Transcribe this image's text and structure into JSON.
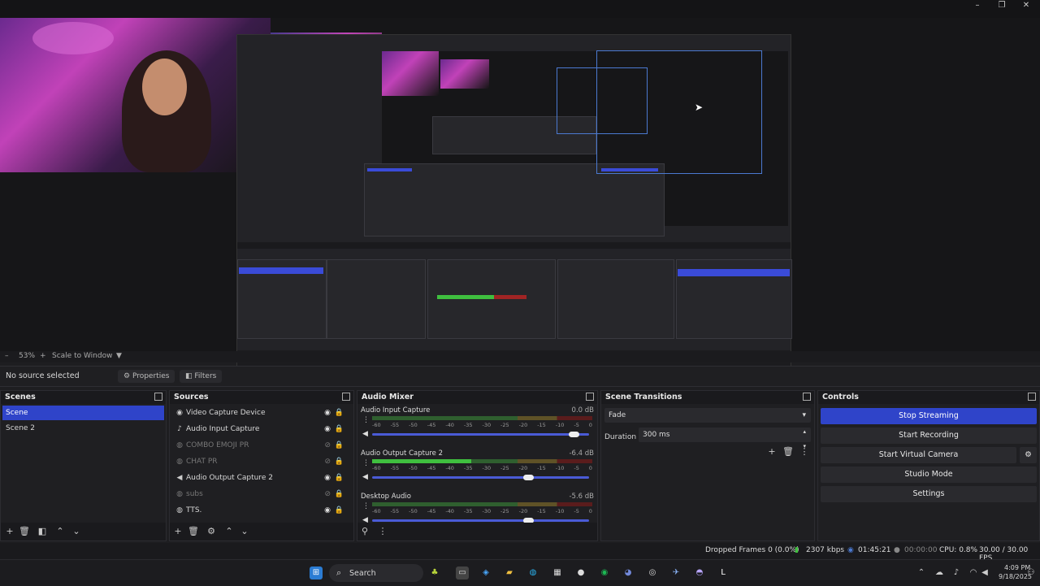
{
  "preview_toolbar": {
    "minus": "–",
    "zoom": "53%",
    "plus": "+",
    "scale_mode": "Scale to Window"
  },
  "props_bar": {
    "no_source": "No source selected",
    "properties": "Properties",
    "filters": "Filters"
  },
  "scenes": {
    "title": "Scenes",
    "items": [
      "Scene",
      "Scene 2"
    ]
  },
  "sources": {
    "title": "Sources",
    "items": [
      {
        "icon": "camera-icon",
        "glyph": "◉",
        "label": "Video Capture Device",
        "visible": true
      },
      {
        "icon": "mic-icon",
        "glyph": "♪",
        "label": "Audio Input Capture",
        "visible": true
      },
      {
        "icon": "browser-icon",
        "glyph": "◍",
        "label": "COMBO EMOJI PR",
        "visible": false
      },
      {
        "icon": "browser-icon",
        "glyph": "◍",
        "label": "CHAT PR",
        "visible": false
      },
      {
        "icon": "speaker-icon",
        "glyph": "◀",
        "label": "Audio Output Capture 2",
        "visible": true
      },
      {
        "icon": "browser-icon",
        "glyph": "◍",
        "label": "subs",
        "visible": false
      },
      {
        "icon": "browser-icon",
        "glyph": "◍",
        "label": "TTS.",
        "visible": true
      }
    ]
  },
  "mixer": {
    "title": "Audio Mixer",
    "ticks": [
      "-60",
      "-55",
      "-50",
      "-45",
      "-40",
      "-35",
      "-30",
      "-25",
      "-20",
      "-15",
      "-10",
      "-5",
      "0"
    ],
    "channels": [
      {
        "name": "Audio Input Capture",
        "db": "0.0 dB",
        "level": 0.0,
        "volume": 0.93
      },
      {
        "name": "Audio Output Capture 2",
        "db": "-6.4 dB",
        "level": 0.45,
        "volume": 0.72
      },
      {
        "name": "Desktop Audio",
        "db": "-5.6 dB",
        "level": 0.0,
        "volume": 0.72
      }
    ]
  },
  "transitions": {
    "title": "Scene Transitions",
    "type": "Fade",
    "duration_label": "Duration",
    "duration_value": "300 ms"
  },
  "controls": {
    "title": "Controls",
    "buttons": [
      "Stop Streaming",
      "Start Recording",
      "Start Virtual Camera",
      "Studio Mode",
      "Settings"
    ]
  },
  "status": {
    "dropped": "Dropped Frames 0 (0.0%)",
    "bitrate": "2307 kbps",
    "stream_time": "01:45:21",
    "rec_time": "00:00:00",
    "cpu": "CPU: 0.8%",
    "fps": "30.00 / 30.00 FPS"
  },
  "taskbar": {
    "search": "Search",
    "time": "4:09 PM",
    "date": "9/18/2025"
  },
  "colors": {
    "accent": "#2f44c9",
    "meter_green": "#3fbf3f",
    "meter_yellow": "#c8a52a",
    "meter_red": "#a02424"
  }
}
